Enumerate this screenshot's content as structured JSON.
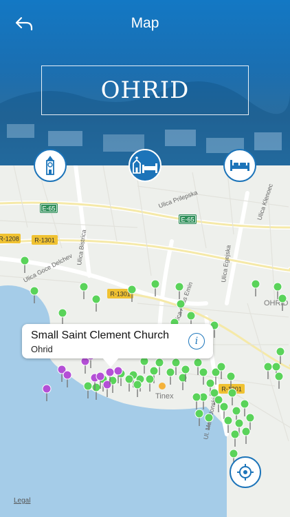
{
  "header": {
    "title": "Map",
    "city": "OHRID"
  },
  "categories": [
    {
      "icon": "clock-tower-icon"
    },
    {
      "icon": "church-hotel-icon",
      "active": true
    },
    {
      "icon": "bed-icon"
    }
  ],
  "map": {
    "road_signs": [
      "E-65",
      "E-65",
      "R-1208",
      "R-1301",
      "R-1301",
      "R-1301"
    ],
    "street_labels": [
      "Ulica Prilepska",
      "Ulica Bistrica",
      "Ulica Goce Delchev",
      "Ulica Egejska",
      "Ulica Klenoec",
      "Ulica Abas Emin",
      "Ul. Makedonski"
    ],
    "place_labels": [
      "OHRID",
      "Tinex"
    ],
    "legal": "Legal"
  },
  "callout": {
    "title": "Small Saint Clement Church",
    "subtitle": "Ohrid"
  },
  "colors": {
    "header_blue": "#1378c4",
    "pin_green": "#5ad35a",
    "pin_purple": "#b44fd6",
    "water": "#a5cce8"
  }
}
